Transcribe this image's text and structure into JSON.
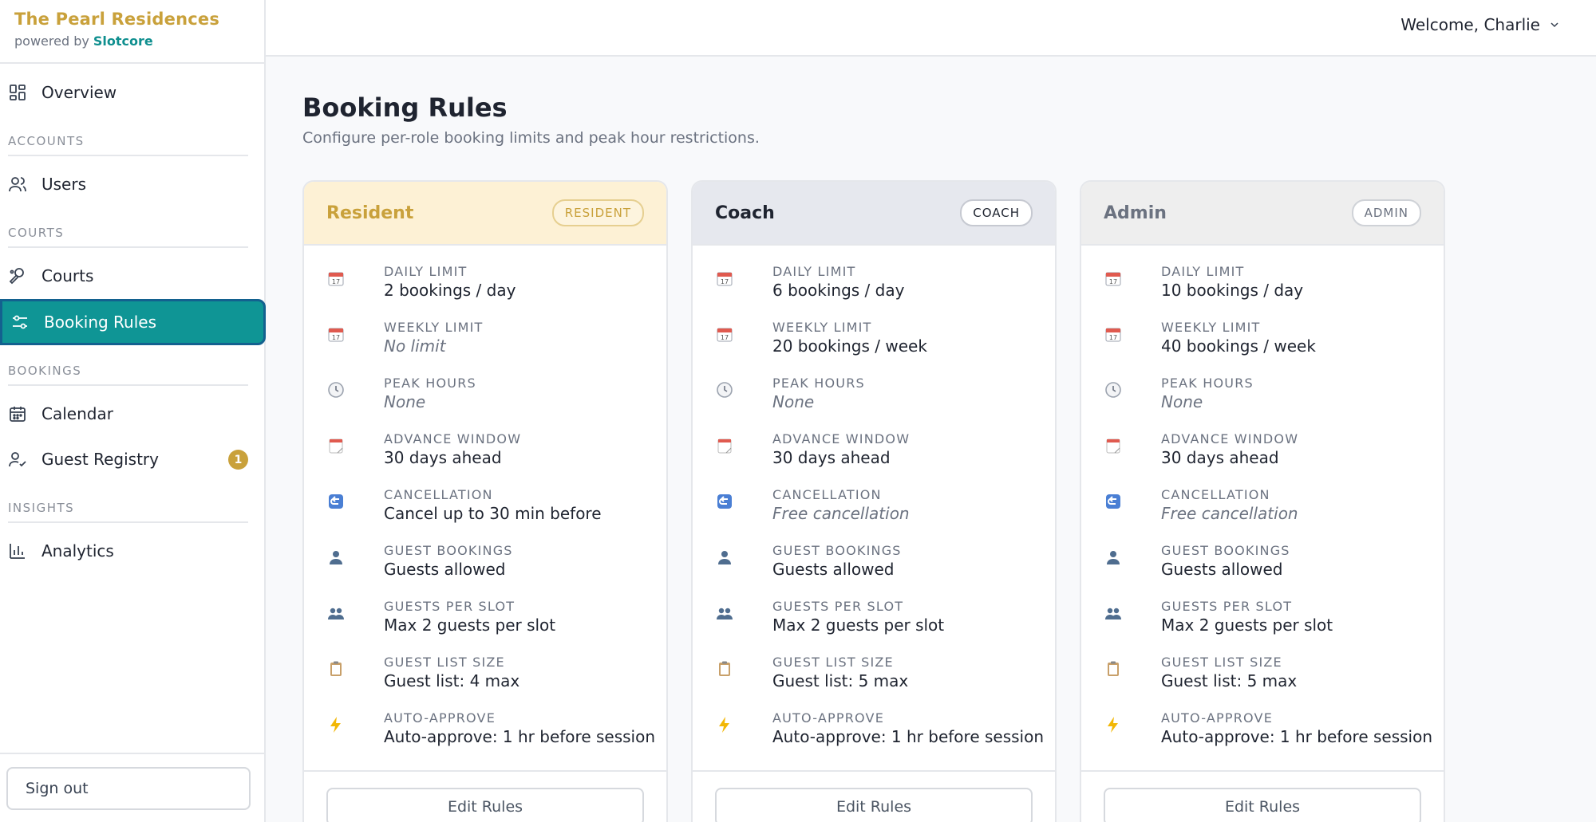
{
  "brand": {
    "title": "The Pearl Residences",
    "powered_by": "powered by",
    "vendor": "Slotcore"
  },
  "header": {
    "welcome": "Welcome, Charlie"
  },
  "sidebar": {
    "overview": "Overview",
    "sections": {
      "accounts": "ACCOUNTS",
      "courts": "COURTS",
      "bookings": "BOOKINGS",
      "insights": "INSIGHTS"
    },
    "items": {
      "users": "Users",
      "courts": "Courts",
      "booking_rules": "Booking Rules",
      "calendar": "Calendar",
      "guest_registry": "Guest Registry",
      "guest_registry_badge": "1",
      "analytics": "Analytics"
    },
    "sign_out": "Sign out"
  },
  "page": {
    "title": "Booking Rules",
    "subtitle": "Configure per-role booking limits and peak hour restrictions."
  },
  "labels": {
    "daily_limit": "DAILY LIMIT",
    "weekly_limit": "WEEKLY LIMIT",
    "peak_hours": "PEAK HOURS",
    "advance_window": "ADVANCE WINDOW",
    "cancellation": "CANCELLATION",
    "guest_bookings": "GUEST BOOKINGS",
    "guests_per_slot": "GUESTS PER SLOT",
    "guest_list_size": "GUEST LIST SIZE",
    "auto_approve": "AUTO-APPROVE",
    "edit_rules": "Edit Rules"
  },
  "roles": [
    {
      "name": "Resident",
      "badge": "RESIDENT",
      "daily_limit": "2 bookings / day",
      "weekly_limit": "No limit",
      "peak_hours": "None",
      "advance_window": "30 days ahead",
      "cancellation": "Cancel up to 30 min before",
      "guest_bookings": "Guests allowed",
      "guests_per_slot": "Max 2 guests per slot",
      "guest_list_size": "Guest list: 4 max",
      "auto_approve": "Auto-approve: 1 hr before session"
    },
    {
      "name": "Coach",
      "badge": "COACH",
      "daily_limit": "6 bookings / day",
      "weekly_limit": "20 bookings / week",
      "peak_hours": "None",
      "advance_window": "30 days ahead",
      "cancellation": "Free cancellation",
      "guest_bookings": "Guests allowed",
      "guests_per_slot": "Max 2 guests per slot",
      "guest_list_size": "Guest list: 5 max",
      "auto_approve": "Auto-approve: 1 hr before session"
    },
    {
      "name": "Admin",
      "badge": "ADMIN",
      "daily_limit": "10 bookings / day",
      "weekly_limit": "40 bookings / week",
      "peak_hours": "None",
      "advance_window": "30 days ahead",
      "cancellation": "Free cancellation",
      "guest_bookings": "Guests allowed",
      "guests_per_slot": "Max 2 guests per slot",
      "guest_list_size": "Guest list: 5 max",
      "auto_approve": "Auto-approve: 1 hr before session"
    }
  ],
  "colors": {
    "accent": "#0f9595",
    "brand_gold": "#c9a13b",
    "active_border": "#13618f"
  },
  "icons": {
    "nav": [
      "dashboard-icon",
      "users-icon",
      "court-icon",
      "sliders-icon",
      "calendar-icon",
      "guest-icon",
      "analytics-icon"
    ],
    "rules": [
      "calendar-icon",
      "calendar-icon",
      "clock-icon",
      "tear-off-calendar-icon",
      "return-arrow-icon",
      "person-icon",
      "people-icon",
      "clipboard-icon",
      "lightning-icon"
    ]
  }
}
